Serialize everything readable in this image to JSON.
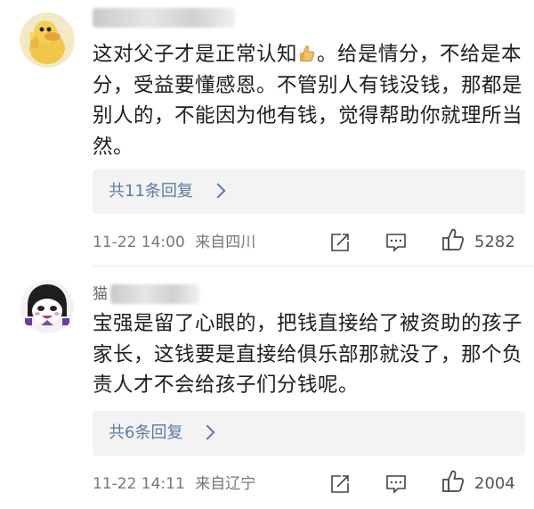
{
  "comments": [
    {
      "username": "",
      "text_before_emoji": "这对父子才是正常认知",
      "emoji": "thumbs-up-emoji",
      "text_after_emoji": "。给是情分，不给是本分，受益要懂感恩。不管别人有钱没钱，那都是别人的，不能因为他有钱，觉得帮助你就理所当然。",
      "reply_label": "共11条回复",
      "timestamp": "11-22 14:00",
      "location": "来自四川",
      "like_count": "5282",
      "avatar": "duck-avatar"
    },
    {
      "username": "猫",
      "text": "宝强是留了心眼的，把钱直接给了被资助的孩子家长，这钱要是直接给俱乐部那就没了，那个负责人才不会给孩子们分钱呢。",
      "reply_label": "共6条回复",
      "timestamp": "11-22 14:11",
      "location": "来自辽宁",
      "like_count": "2004",
      "avatar": "cartoon-girl-avatar"
    }
  ],
  "colors": {
    "link": "#5a7ba6",
    "meta": "#777777",
    "reply_bg": "#f3f3f3"
  }
}
